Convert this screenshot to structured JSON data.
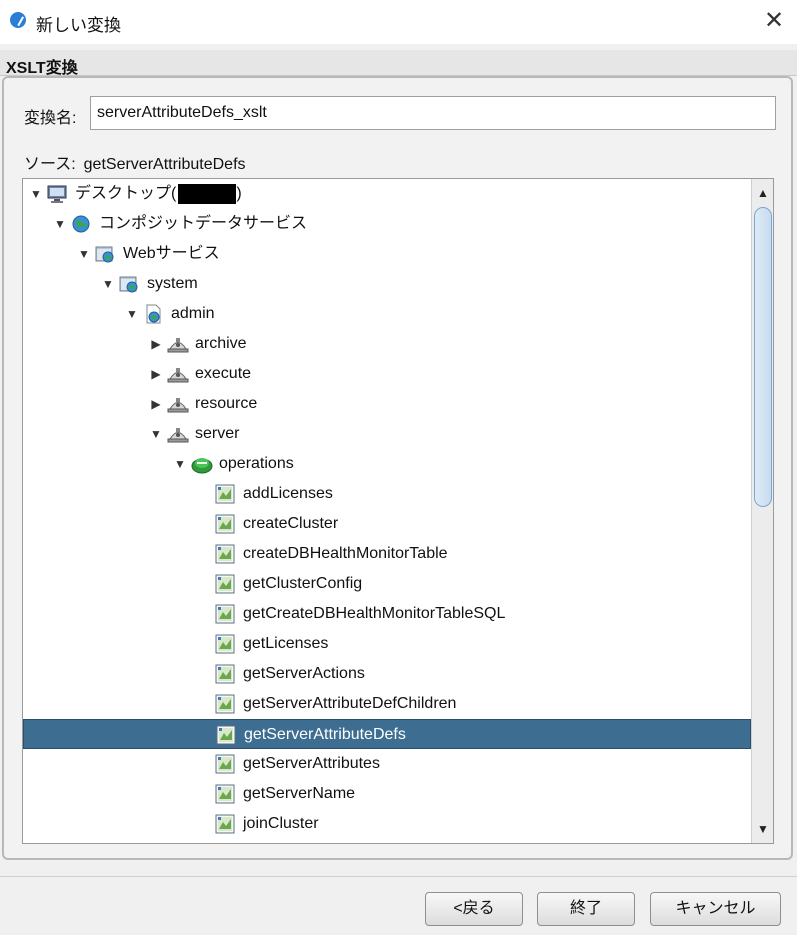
{
  "window": {
    "title": "新しい変換",
    "close_glyph": "✕"
  },
  "section": {
    "title": "XSLT変換"
  },
  "form": {
    "name_label": "変換名:",
    "name_value": "serverAttributeDefs_xslt",
    "source_label": "ソース:",
    "source_value": "getServerAttributeDefs"
  },
  "tree": {
    "items": [
      {
        "label": "デスクトップ(",
        "suffix": ")",
        "redacted": true,
        "expanded": true,
        "icon": "desktop-icon"
      },
      {
        "label": "コンポジットデータサービス",
        "expanded": true,
        "icon": "globe-icon"
      },
      {
        "label": "Webサービス",
        "expanded": true,
        "icon": "web-folder-icon"
      },
      {
        "label": "system",
        "expanded": true,
        "icon": "web-folder-icon"
      },
      {
        "label": "admin",
        "expanded": true,
        "icon": "wsdl-file-icon"
      },
      {
        "label": "archive",
        "expanded": false,
        "icon": "service-port-icon"
      },
      {
        "label": "execute",
        "expanded": false,
        "icon": "service-port-icon"
      },
      {
        "label": "resource",
        "expanded": false,
        "icon": "service-port-icon"
      },
      {
        "label": "server",
        "expanded": true,
        "icon": "service-port-icon"
      },
      {
        "label": "operations",
        "expanded": true,
        "icon": "operations-icon"
      },
      {
        "label": "addLicenses",
        "icon": "operation-icon"
      },
      {
        "label": "createCluster",
        "icon": "operation-icon"
      },
      {
        "label": "createDBHealthMonitorTable",
        "icon": "operation-icon"
      },
      {
        "label": "getClusterConfig",
        "icon": "operation-icon"
      },
      {
        "label": "getCreateDBHealthMonitorTableSQL",
        "icon": "operation-icon"
      },
      {
        "label": "getLicenses",
        "icon": "operation-icon"
      },
      {
        "label": "getServerActions",
        "icon": "operation-icon"
      },
      {
        "label": "getServerAttributeDefChildren",
        "icon": "operation-icon"
      },
      {
        "label": "getServerAttributeDefs",
        "icon": "operation-icon",
        "selected": true
      },
      {
        "label": "getServerAttributes",
        "icon": "operation-icon"
      },
      {
        "label": "getServerName",
        "icon": "operation-icon"
      },
      {
        "label": "joinCluster",
        "icon": "operation-icon"
      }
    ],
    "selection_color": "#3d6d90"
  },
  "scroll": {
    "up_glyph": "▲",
    "down_glyph": "▼"
  },
  "buttons": {
    "back_label": "<戻る",
    "finish_label": "終了",
    "cancel_label": "キャンセル"
  }
}
